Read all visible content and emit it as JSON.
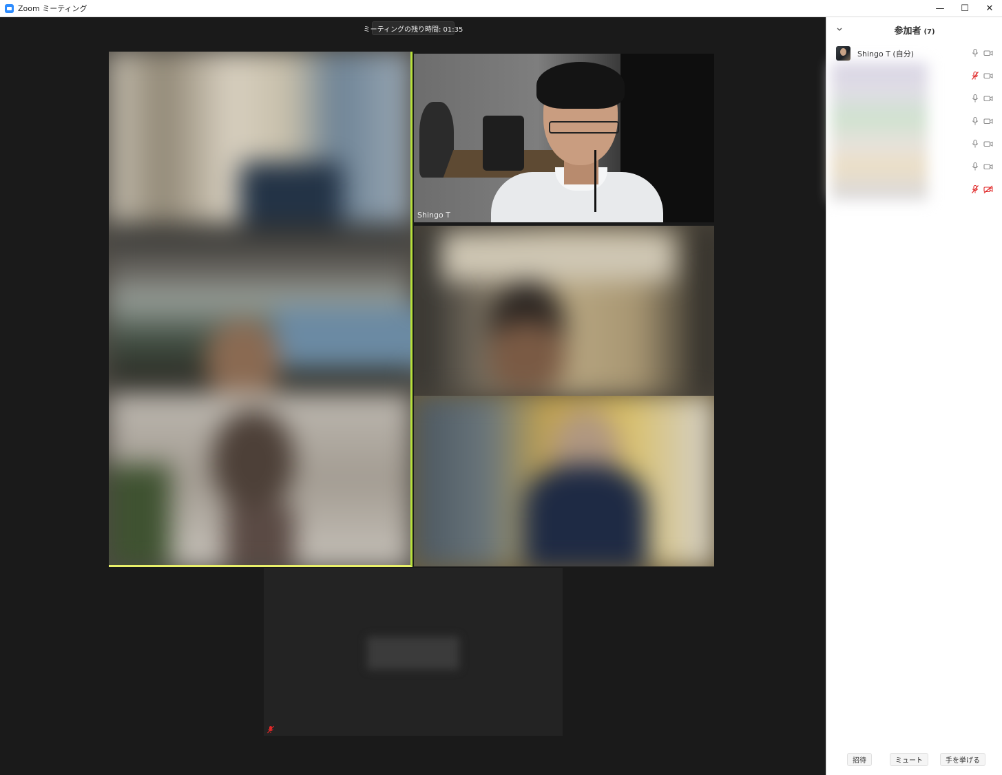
{
  "window": {
    "title": "Zoom ミーティング",
    "controls": {
      "minimize": "—",
      "maximize": "☐",
      "close": "✕"
    }
  },
  "meeting": {
    "timer_text": "ミーティングの残り時間: 01:35"
  },
  "tiles": {
    "speaker_name": "Shingo T"
  },
  "participants_panel": {
    "title": "参加者",
    "count": "(7)",
    "self_name": "Shingo T (自分)",
    "rows": [
      {
        "mic": "mic-on",
        "video": "video-on"
      },
      {
        "mic": "mic-muted",
        "video": "video-on"
      },
      {
        "mic": "mic-on",
        "video": "video-on"
      },
      {
        "mic": "mic-on",
        "video": "video-on"
      },
      {
        "mic": "mic-on",
        "video": "video-on"
      },
      {
        "mic": "mic-on",
        "video": "video-on"
      },
      {
        "mic": "mic-muted",
        "video": "video-off"
      }
    ],
    "buttons": {
      "invite": "招待",
      "mute_all": "ミュート",
      "raise_hand": "手を挙げる"
    }
  },
  "colors": {
    "active_speaker_border": "#e9f06a",
    "muted_red": "#e02828",
    "accent": "#2d8cff"
  }
}
